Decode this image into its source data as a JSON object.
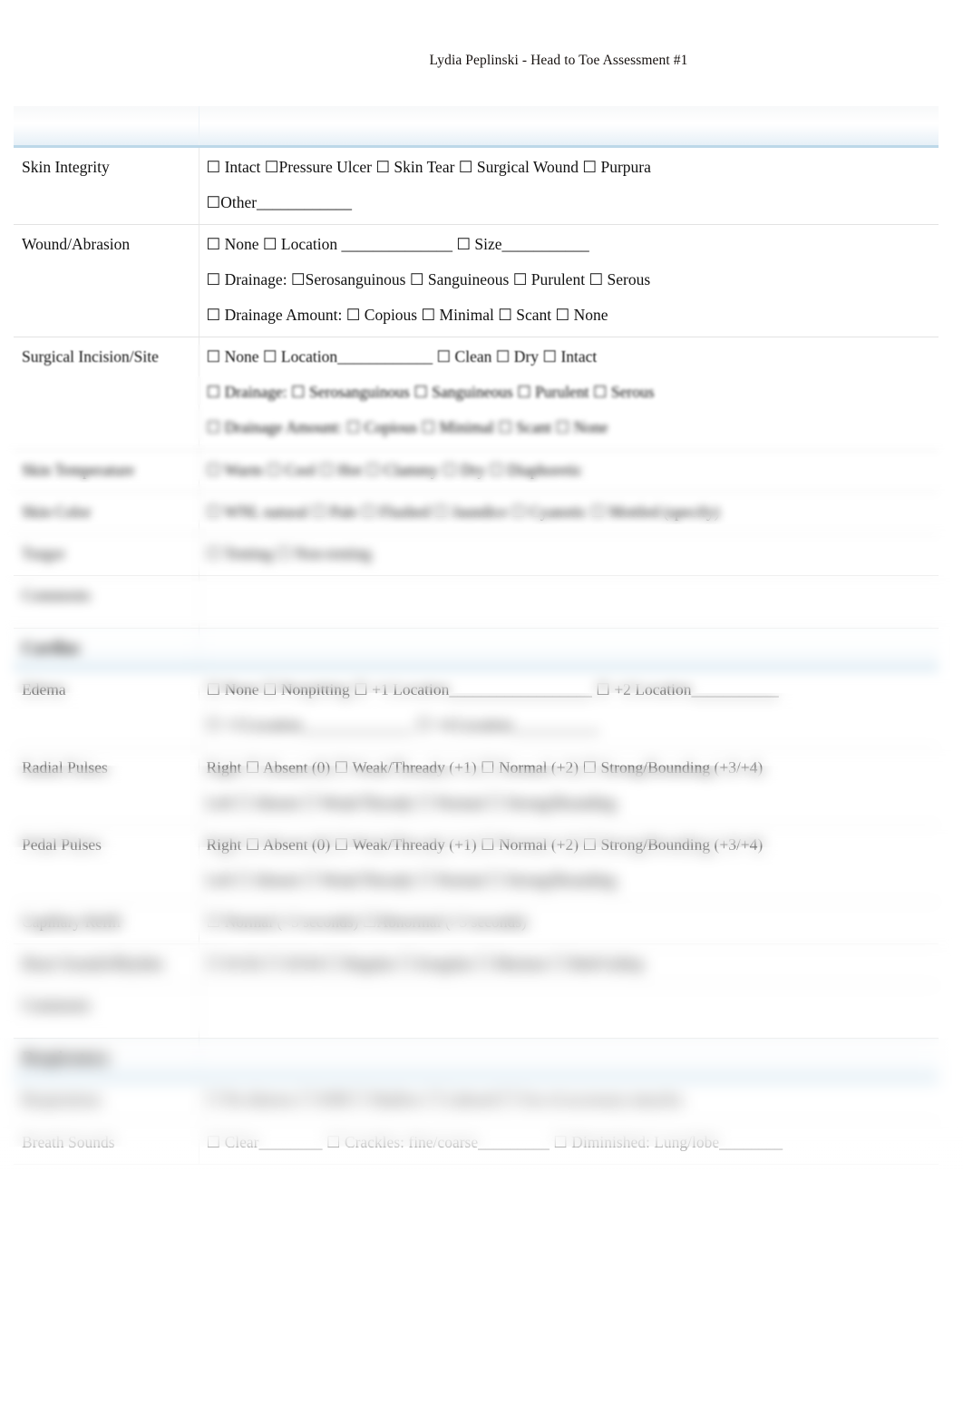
{
  "header": {
    "running_title": "Lydia Peplinski - Head to Toe Assessment #1"
  },
  "form": {
    "banner_row_label": "",
    "rows": [
      {
        "label": "Skin Integrity",
        "lines": [
          "☐ Intact     ☐Pressure Ulcer       ☐ Skin Tear      ☐ Surgical Wound     ☐ Purpura",
          "☐Other____________"
        ]
      },
      {
        "label": "Wound/Abrasion",
        "lines": [
          "☐ None       ☐ Location ______________            ☐ Size___________",
          "☐ Drainage:  ☐Serosanguinous     ☐ Sanguineous     ☐ Purulent    ☐ Serous",
          "☐ Drainage Amount:   ☐ Copious   ☐ Minimal  ☐ Scant   ☐ None"
        ]
      },
      {
        "label": "Surgical Incision/Site",
        "lines": [
          "☐ None    ☐ Location____________         ☐ Clean      ☐ Dry   ☐ Intact",
          "☐  Drainage:   ☐ Serosanguinous   ☐ Sanguineous   ☐ Purulent   ☐ Serous",
          "☐ Drainage Amount:  ☐ Copious   ☐ Minimal   ☐ Scant   ☐ None"
        ]
      },
      {
        "label": "Skin Temperature",
        "lines": [
          "☐ Warm     ☐ Cool     ☐ Hot     ☐ Clammy      ☐ Dry    ☐ Diaphoretic"
        ]
      },
      {
        "label": "Skin Color",
        "lines": [
          "☐ WNL natural    ☐ Pale    ☐ Flushed    ☐ Jaundice    ☐ Cyanotic   ☐ Mottled (specify)"
        ]
      },
      {
        "label": "Turgor",
        "lines": [
          "☐ Tenting    ☐ Non-tenting"
        ]
      },
      {
        "label": "Comments",
        "lines": [
          ""
        ],
        "comment": true
      }
    ],
    "sections": [
      {
        "title": "Cardiac",
        "rows": [
          {
            "label": "Edema",
            "lines": [
              "☐ None      ☐ Nonpitting   ☐ +1 Location__________________   ☐ +2 Location___________",
              "                      ☐ +3 Location______________   ☐ +4 Location___________"
            ]
          },
          {
            "label": "Radial Pulses",
            "lines": [
              "Right ☐ Absent (0) ☐ Weak/Thready (+1)    ☐ Normal (+2)   ☐ Strong/Bounding (+3/+4)",
              "Left ☐ Absent   ☐ Weak/Thready     ☐ Normal   ☐ Strong/Bounding"
            ]
          },
          {
            "label": "Pedal Pulses",
            "lines": [
              "Right ☐ Absent (0)  ☐ Weak/Thready (+1)   ☐ Normal (+2)   ☐ Strong/Bounding (+3/+4)",
              "Left ☐ Absent    ☐ Weak/Thready     ☐ Normal   ☐ Strong/Bounding"
            ]
          },
          {
            "label": "Capillary Refill",
            "lines": [
              "☐ Normal (<3 seconds)  ☐Abnormal (>3 seconds)"
            ]
          },
          {
            "label": "Heart Sounds/Rhythm",
            "lines": [
              "☐ S1/S2 ☐ S3/S4     ☐ Regular     ☐ Irregular    ☐ Murmur     ☐ Rub/Gallop"
            ]
          },
          {
            "label": "Comments",
            "lines": [
              ""
            ],
            "comment": true
          }
        ]
      },
      {
        "title": "Respiratory",
        "rows": [
          {
            "label": "Respirations",
            "lines": [
              "☐ No distress      ☐ SOB      ☐ Shallow      ☐ Labored    ☐ Use of accessory muscles"
            ]
          },
          {
            "label": "Breath Sounds",
            "lines": [
              "☐ Clear________     ☐ Crackles: fine/coarse_________    ☐ Diminished: Lung/lobe________"
            ]
          }
        ]
      }
    ]
  },
  "colors": {
    "section_rule": "#bcd8e8",
    "row_rule": "#e2e2e2",
    "text": "#111111",
    "page_background": "#ffffff"
  }
}
